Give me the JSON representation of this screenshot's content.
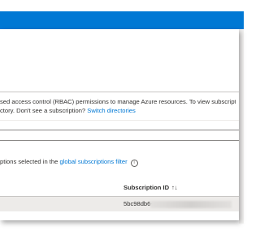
{
  "info": {
    "line1": "sed access control (RBAC) permissions to manage Azure resources. To view subscription",
    "line2_text": "ctory. Don't see a subscription? ",
    "line2_link": "Switch directories"
  },
  "filter": {
    "text": "ptions selected in the ",
    "link": "global subscriptions filter",
    "info_icon_glyph": "i"
  },
  "table": {
    "columns": [
      {
        "label": "Subscription ID",
        "sort_glyph": "↑↓"
      }
    ],
    "rows": [
      {
        "subscription_id": "5bc98db6-"
      }
    ]
  },
  "colors": {
    "accent": "#0078d4",
    "row_selected": "#edebe9"
  }
}
